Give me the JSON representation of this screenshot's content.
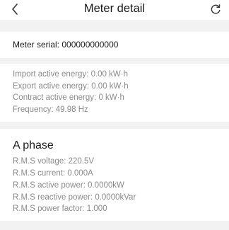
{
  "header": {
    "title": "Meter detail",
    "back_icon": "chevron-left-icon",
    "refresh_icon": "refresh-icon"
  },
  "serial": {
    "text": "Meter serial: 000000000000"
  },
  "energy": {
    "rows": [
      "Import active energy:  0.00 kW·h",
      "Export active energy:  0.00 kW·h",
      "Contract active energy:  0 kW·h",
      "Frequency:  49.98 Hz"
    ]
  },
  "phase_a": {
    "title": "A phase",
    "rows": [
      "R.M.S voltage:  220.5V",
      "R.M.S current:  0.000A",
      "R.M.S active power:  0.0000kW",
      "R.M.S reactive power:  0.0000kVar",
      "R.M.S power factor:  1.000"
    ]
  },
  "colors": {
    "background": "#f2f2f2",
    "card": "#ffffff",
    "primary_text": "#1a1a1a",
    "secondary_text": "#8a8a8a"
  }
}
